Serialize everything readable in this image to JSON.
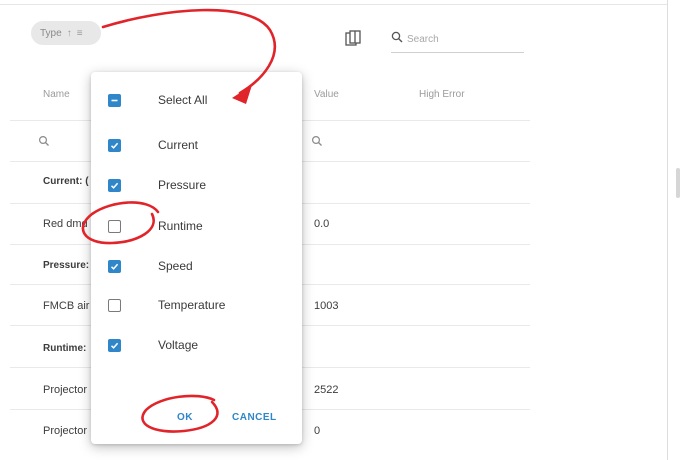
{
  "toolbar": {
    "type_chip_label": "Type",
    "sort_icon": "arrow-up-icon",
    "filter_icon": "filter-lines-icon",
    "columns_icon": "columns-icon",
    "search_placeholder": "Search",
    "search_value": ""
  },
  "table": {
    "columns": [
      "Name",
      "Value",
      "High Error"
    ],
    "rows": [
      {
        "name": "Current: (",
        "value": ""
      },
      {
        "name": "Red dmd",
        "value": "0.0"
      },
      {
        "name": "Pressure:",
        "value": ""
      },
      {
        "name": "FMCB air",
        "value": "1003"
      },
      {
        "name": "Runtime:",
        "value": ""
      },
      {
        "name": "Projector",
        "value": "2522"
      },
      {
        "name": "Projector",
        "value": "0"
      }
    ]
  },
  "type_filter_popup": {
    "select_all_label": "Select All",
    "select_all_state": "indeterminate",
    "options": [
      {
        "label": "Current",
        "checked": true
      },
      {
        "label": "Pressure",
        "checked": true
      },
      {
        "label": "Runtime",
        "checked": false
      },
      {
        "label": "Speed",
        "checked": true
      },
      {
        "label": "Temperature",
        "checked": false
      },
      {
        "label": "Voltage",
        "checked": true
      }
    ],
    "ok_label": "OK",
    "cancel_label": "CANCEL"
  },
  "colors": {
    "accent": "#2f86c8",
    "annotation": "#e0242a"
  }
}
